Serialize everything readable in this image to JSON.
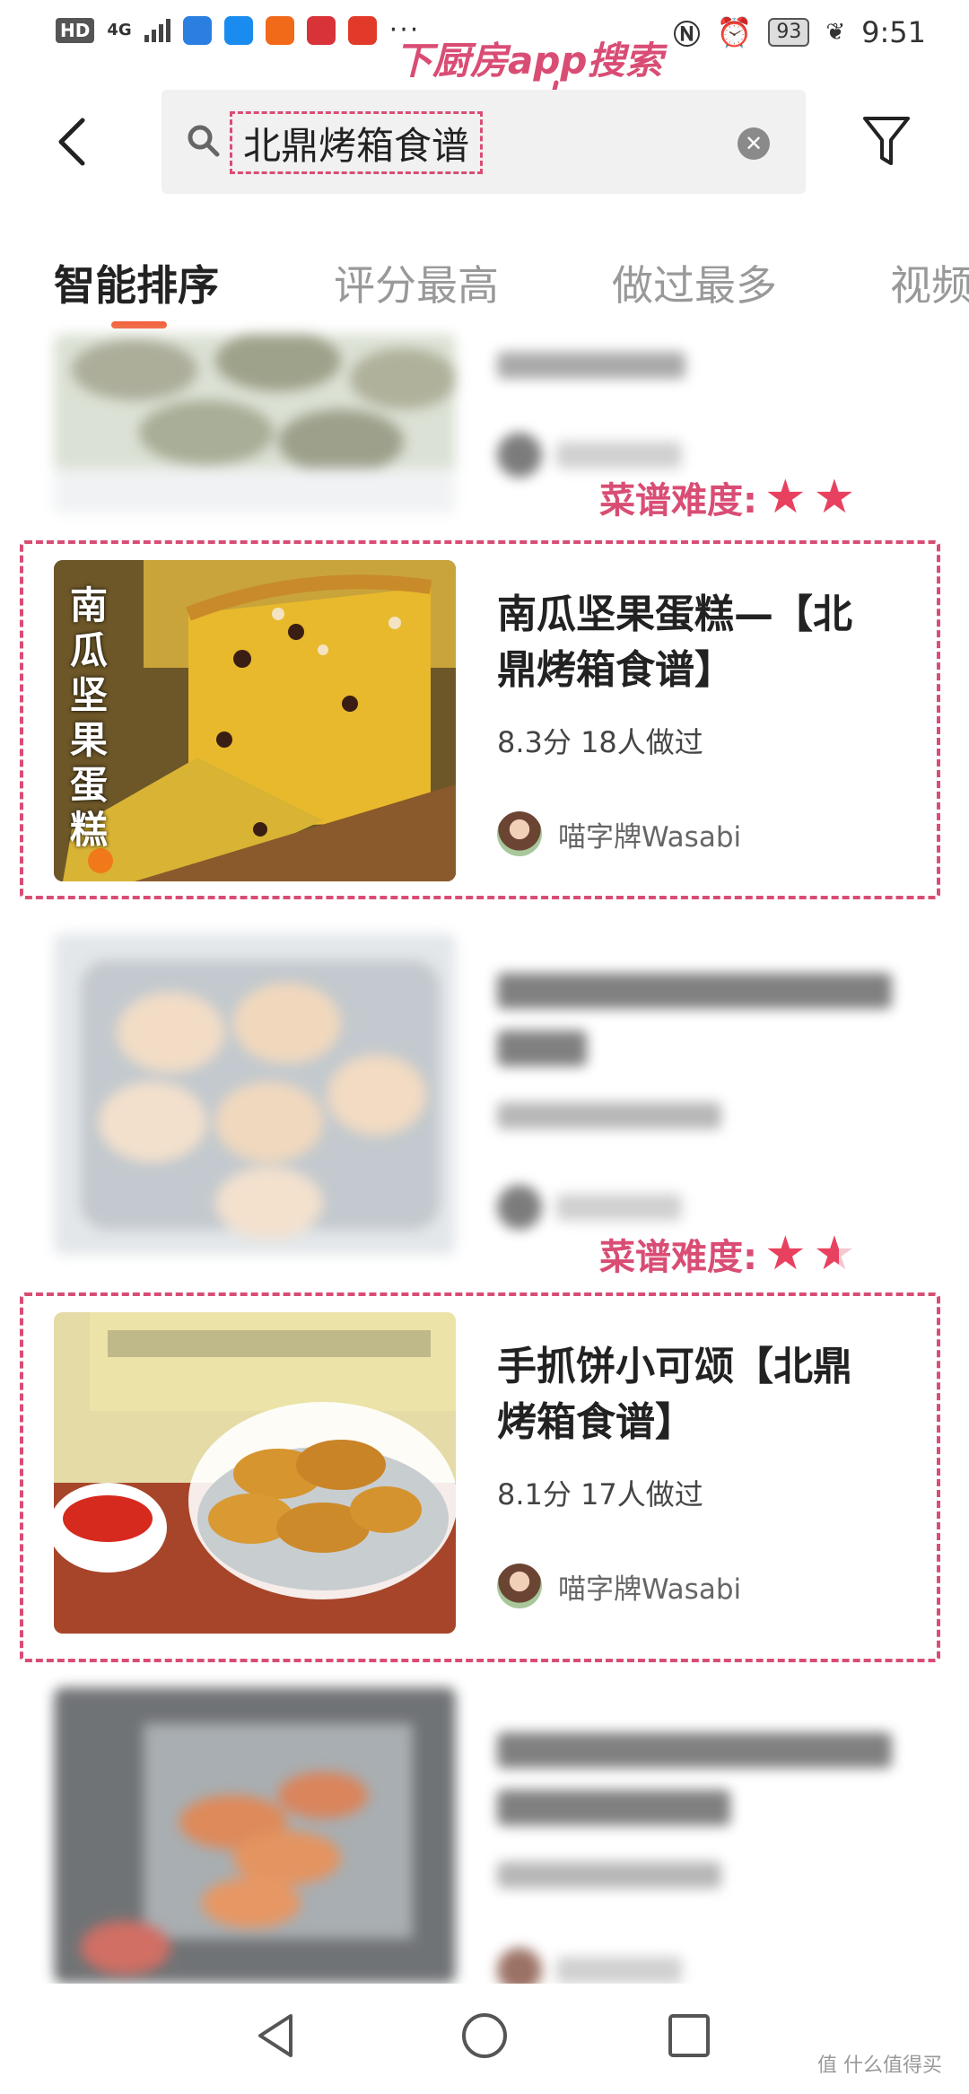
{
  "status_bar": {
    "hd": "HD",
    "network": "4G",
    "battery": "93",
    "time": "9:51"
  },
  "annotation_top": "下厨房app搜索",
  "search": {
    "query": "北鼎烤箱食谱"
  },
  "sort_tabs": [
    "智能排序",
    "评分最高",
    "做过最多",
    "视频"
  ],
  "difficulty_label": "菜谱难度:",
  "recipes": [
    {
      "title": "南瓜坚果蛋糕—【北鼎烤箱食谱】",
      "title_line1": "南瓜坚果蛋糕—【北",
      "title_line2": "鼎烤箱食谱】",
      "meta": "8.3分 18人做过",
      "author": "喵字牌Wasabi",
      "image_text": "南瓜坚果蛋糕",
      "difficulty_stars": 2
    },
    {
      "title": "手抓饼小可颂【北鼎烤箱食谱】",
      "title_line1": "手抓饼小可颂【北鼎",
      "title_line2": "烤箱食谱】",
      "meta": "8.1分 17人做过",
      "author": "喵字牌Wasabi",
      "difficulty_stars": 1.5
    }
  ],
  "watermark": "值 什么值得买",
  "colors": {
    "annotation": "#d94d74",
    "accent": "#f2623b",
    "star": "#e8415f"
  }
}
